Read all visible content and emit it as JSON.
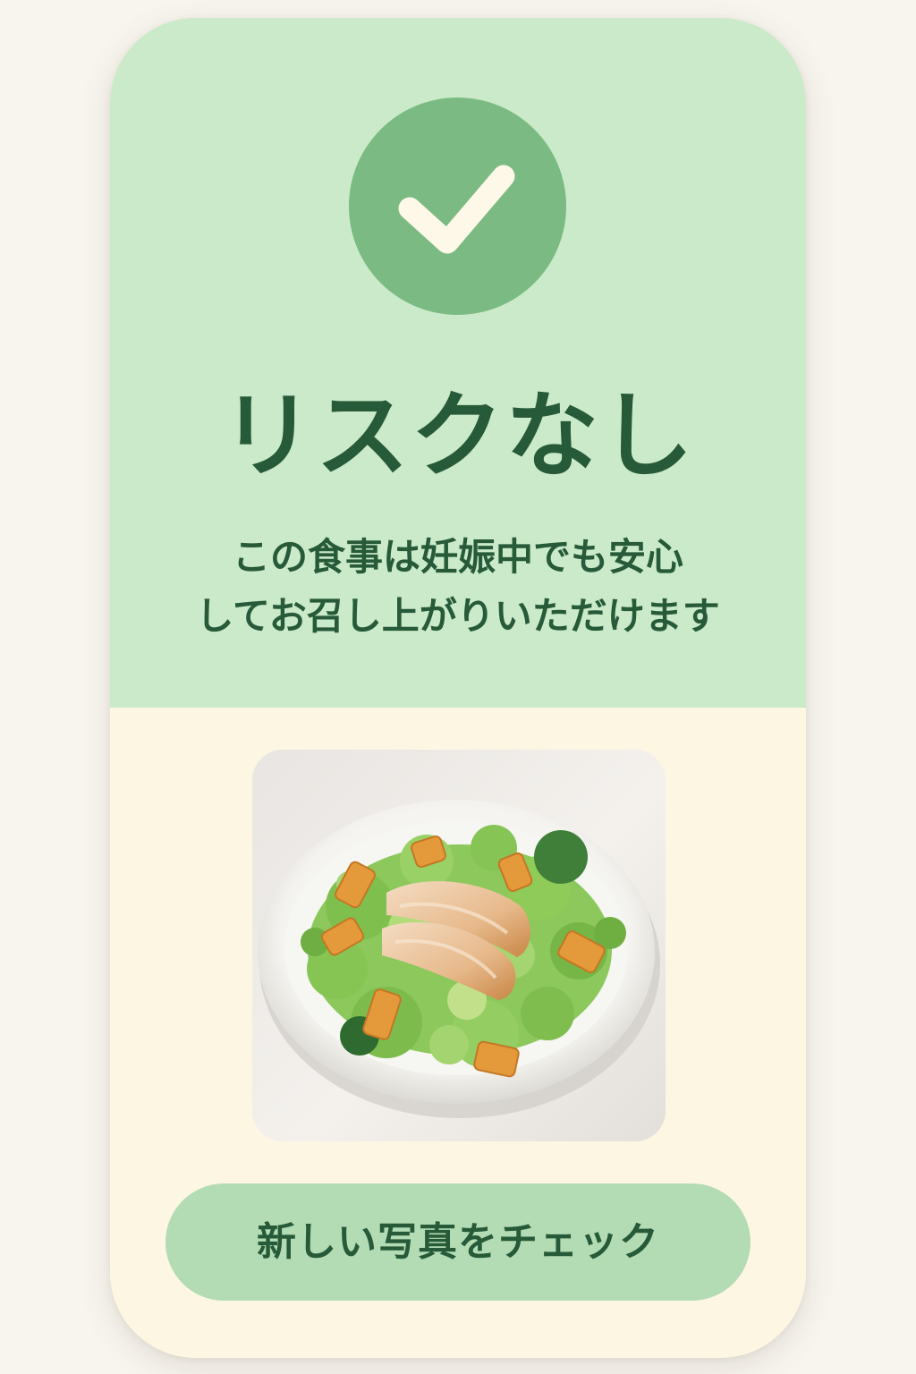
{
  "result": {
    "icon": "check-icon",
    "title": "リスクなし",
    "message_line1": "この食事は妊娠中でも安心",
    "message_line2": "してお召し上がりいただけます"
  },
  "photo": {
    "subject": "salad-with-chicken"
  },
  "actions": {
    "check_new_photo_label": "新しい写真をチェック"
  },
  "colors": {
    "top_panel": "#cbeac9",
    "badge": "#7bbb83",
    "text": "#265a39",
    "bottom_panel": "#fdf6e3",
    "button": "#b4dcb4"
  }
}
